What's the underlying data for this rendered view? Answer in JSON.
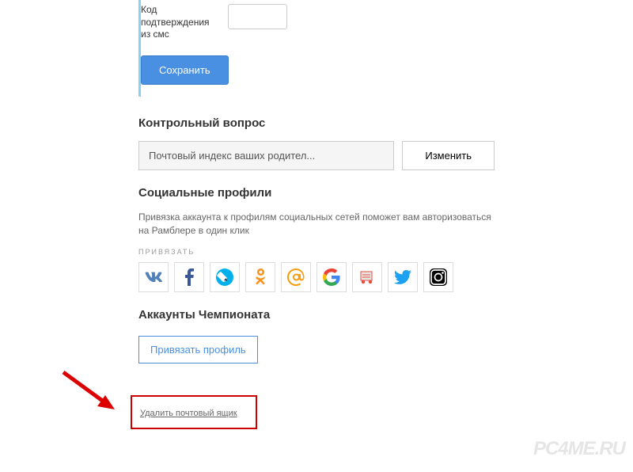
{
  "sms": {
    "label": "Код подтверждения из смс"
  },
  "buttons": {
    "save": "Сохранить",
    "change": "Изменить",
    "bind_profile": "Привязать профиль"
  },
  "security_question": {
    "title": "Контрольный вопрос",
    "value": "Почтовый индекс ваших родител..."
  },
  "social": {
    "title": "Социальные профили",
    "description": "Привязка аккаунта к профилям социальных сетей поможет вам авторизоваться на Рамблере в один клик",
    "bind_label": "ПРИВЯЗАТЬ",
    "networks": [
      "vk",
      "facebook",
      "livejournal",
      "odnoklassniki",
      "mailru",
      "google",
      "yandex",
      "twitter",
      "instagram"
    ]
  },
  "championship": {
    "title": "Аккаунты Чемпионата"
  },
  "delete": {
    "label": "Удалить почтовый ящик"
  },
  "watermark": "PC4ME.RU"
}
